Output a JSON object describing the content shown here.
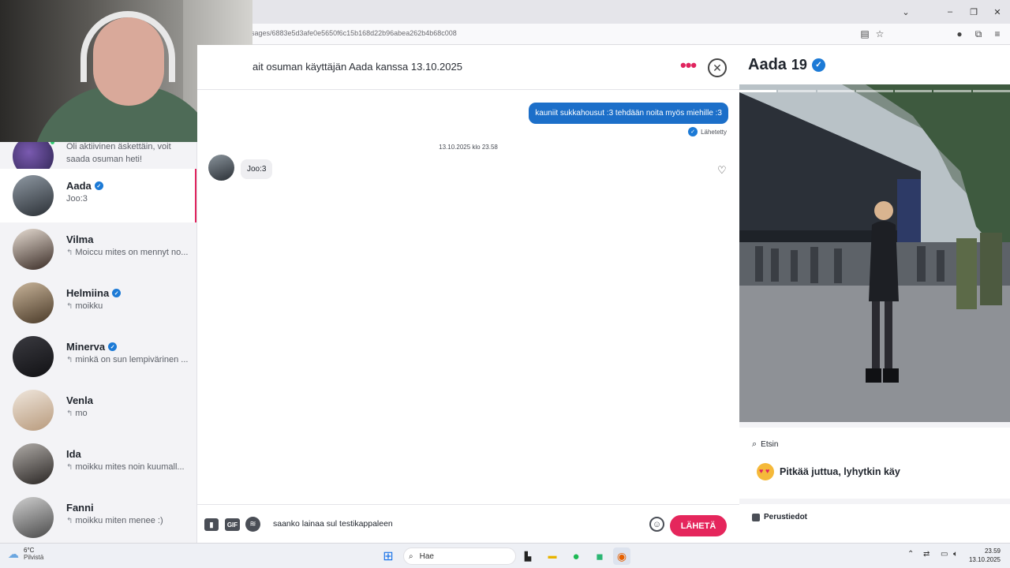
{
  "browser": {
    "url": "sages/6883e5d3afe0e5650f6c15b168d22b96abea262b4b68c008",
    "window_controls": [
      "chevron",
      "minimize",
      "maximize",
      "close"
    ]
  },
  "sidebar": {
    "top_item": {
      "preview": "Oli aktiivinen äskettäin, voit saada osuman heti!"
    },
    "conversations": [
      {
        "name": "Aada",
        "verified": true,
        "preview": "Joo:3",
        "reply": false,
        "active": true
      },
      {
        "name": "Vilma",
        "verified": false,
        "preview": "Moiccu mites on mennyt no...",
        "reply": true
      },
      {
        "name": "Helmiina",
        "verified": true,
        "preview": "moikku",
        "reply": true
      },
      {
        "name": "Minerva",
        "verified": true,
        "preview": "minkä on sun lempivärinen ...",
        "reply": true
      },
      {
        "name": "Venla",
        "verified": false,
        "preview": "mo",
        "reply": true
      },
      {
        "name": "Ida",
        "verified": false,
        "preview": "moikku mites noin kuumall...",
        "reply": true
      },
      {
        "name": "Fanni",
        "verified": false,
        "preview": "moikku miten menee :)",
        "reply": true
      }
    ]
  },
  "chat": {
    "title": "ait osuman käyttäjän Aada kanssa 13.10.2025",
    "outgoing_message": "kauniit sukkahousut :3 tehdään noita myös miehille :3",
    "sent_status": "Lähetetty",
    "timestamp": "13.10.2025 klo 23.58",
    "incoming_message": "Joo:3",
    "composer": {
      "gif_label": "GIF",
      "input_value": "saanko lainaa sul testikappaleen",
      "send_label": "LÄHETÄ"
    }
  },
  "profile": {
    "name": "Aada",
    "age": "19",
    "verified": true,
    "photo_segments": 7,
    "etsin_label": "Etsin",
    "looking_for": "Pitkää juttua, lyhytkin käy",
    "basic_info_label": "Perustiedot"
  },
  "taskbar": {
    "temperature": "6°C",
    "weather": "Pilvistä",
    "search_placeholder": "Hae",
    "time": "23.59",
    "date": "13.10.2025"
  },
  "colors": {
    "accent": "#e5265c",
    "outgoing_bubble": "#1c6fc9",
    "verified": "#1c7ad6"
  }
}
